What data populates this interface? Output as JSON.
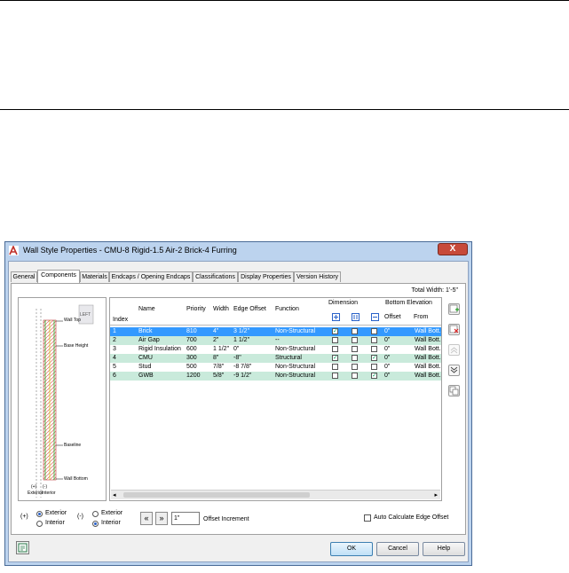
{
  "window": {
    "title": "Wall Style Properties - CMU-8 Rigid-1.5 Air-2 Brick-4 Furring",
    "close_label": "X"
  },
  "tabs": [
    "General",
    "Components",
    "Materials",
    "Endcaps / Opening Endcaps",
    "Classifications",
    "Display Properties",
    "Version History"
  ],
  "total_width": "Total Width: 1'-5\"",
  "preview": {
    "view_label": "LEFT",
    "labels": [
      "Wall Top",
      "Base Height",
      "Baseline",
      "Wall Bottom"
    ],
    "legend": [
      "(+)",
      "(-)",
      "Exterior",
      "Interior"
    ]
  },
  "table": {
    "headers": {
      "index": "Index",
      "name": "Name",
      "priority": "Priority",
      "width": "Width",
      "edge_offset": "Edge Offset",
      "function": "Function",
      "dimension": "Dimension",
      "bottom_elevation": "Bottom Elevation",
      "offset": "Offset",
      "from": "From"
    },
    "rows": [
      {
        "index": "1",
        "name": "Brick",
        "priority": "810",
        "width": "4\"",
        "edge_offset": "3 1/2\"",
        "function": "Non-Structural",
        "dim1": true,
        "dim2": false,
        "dim3": false,
        "offset": "0\"",
        "from": "Wall Bott..."
      },
      {
        "index": "2",
        "name": "Air Gap",
        "priority": "700",
        "width": "2\"",
        "edge_offset": "1 1/2\"",
        "function": "--",
        "dim1": false,
        "dim2": false,
        "dim3": false,
        "offset": "0\"",
        "from": "Wall Bott..."
      },
      {
        "index": "3",
        "name": "Rigid Insulation",
        "priority": "600",
        "width": "1 1/2\"",
        "edge_offset": "0\"",
        "function": "Non-Structural",
        "dim1": false,
        "dim2": false,
        "dim3": false,
        "offset": "0\"",
        "from": "Wall Bott..."
      },
      {
        "index": "4",
        "name": "CMU",
        "priority": "300",
        "width": "8\"",
        "edge_offset": "-8\"",
        "function": "Structural",
        "dim1": true,
        "dim2": false,
        "dim3": true,
        "offset": "0\"",
        "from": "Wall Bott..."
      },
      {
        "index": "5",
        "name": "Stud",
        "priority": "500",
        "width": "7/8\"",
        "edge_offset": "-8 7/8\"",
        "function": "Non-Structural",
        "dim1": false,
        "dim2": false,
        "dim3": false,
        "offset": "0\"",
        "from": "Wall Bott..."
      },
      {
        "index": "6",
        "name": "GWB",
        "priority": "1200",
        "width": "5/8\"",
        "edge_offset": "-9 1/2\"",
        "function": "Non-Structural",
        "dim1": false,
        "dim2": false,
        "dim3": true,
        "offset": "0\"",
        "from": "Wall Bott..."
      }
    ]
  },
  "bottom": {
    "plus_label": "(+)",
    "minus_label": "(-)",
    "exterior_label": "Exterior",
    "interior_label": "Interior",
    "offset_value": "1\"",
    "offset_increment_label": "Offset Increment",
    "auto_calc_label": "Auto Calculate Edge Offset"
  },
  "buttons": {
    "ok": "OK",
    "cancel": "Cancel",
    "help": "Help"
  },
  "colors": {
    "selection": "#3399ff",
    "alt_row": "#c9eadb",
    "frame": "#bcd3ee",
    "close": "#c74a3a"
  }
}
